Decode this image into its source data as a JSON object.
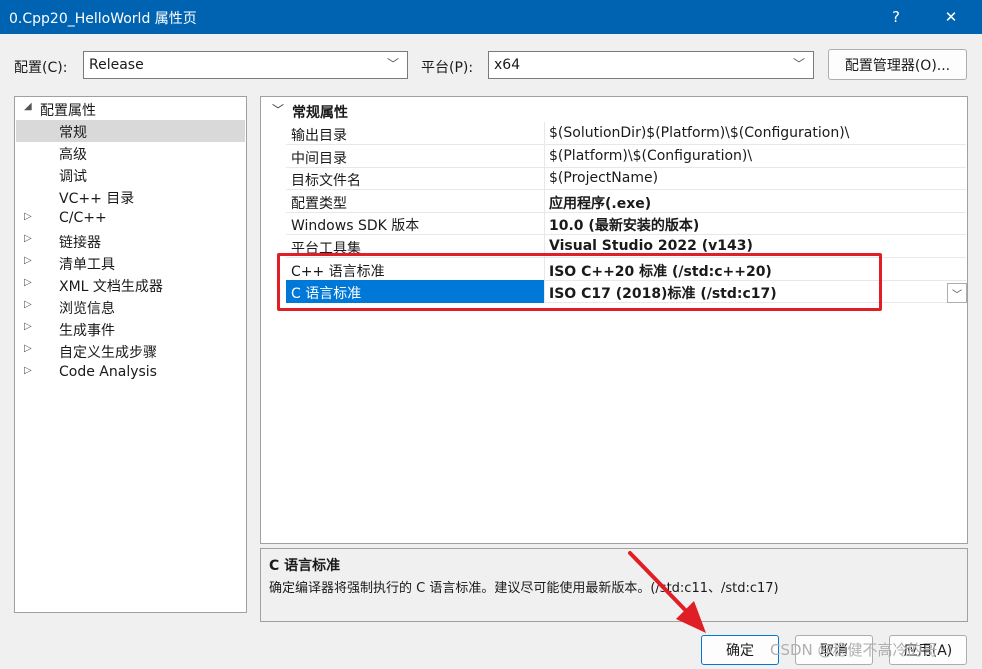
{
  "window": {
    "title": "0.Cpp20_HelloWorld 属性页",
    "help_glyph": "?",
    "close_glyph": "✕"
  },
  "config": {
    "label": "配置(C):",
    "value": "Release",
    "platform_label": "平台(P):",
    "platform_value": "x64",
    "manager_button": "配置管理器(O)..."
  },
  "tree": {
    "items": [
      {
        "label": "配置属性",
        "expander": "◢",
        "level": 0,
        "selected": false
      },
      {
        "label": "常规",
        "expander": "",
        "level": 1,
        "selected": true
      },
      {
        "label": "高级",
        "expander": "",
        "level": 1,
        "selected": false
      },
      {
        "label": "调试",
        "expander": "",
        "level": 1,
        "selected": false
      },
      {
        "label": "VC++ 目录",
        "expander": "",
        "level": 1,
        "selected": false
      },
      {
        "label": "C/C++",
        "expander": "▷",
        "level": 1,
        "selected": false
      },
      {
        "label": "链接器",
        "expander": "▷",
        "level": 1,
        "selected": false
      },
      {
        "label": "清单工具",
        "expander": "▷",
        "level": 1,
        "selected": false
      },
      {
        "label": "XML 文档生成器",
        "expander": "▷",
        "level": 1,
        "selected": false
      },
      {
        "label": "浏览信息",
        "expander": "▷",
        "level": 1,
        "selected": false
      },
      {
        "label": "生成事件",
        "expander": "▷",
        "level": 1,
        "selected": false
      },
      {
        "label": "自定义生成步骤",
        "expander": "▷",
        "level": 1,
        "selected": false
      },
      {
        "label": "Code Analysis",
        "expander": "▷",
        "level": 1,
        "selected": false
      }
    ]
  },
  "grid": {
    "category": "常规属性",
    "rows": [
      {
        "name": "输出目录",
        "value": "$(SolutionDir)$(Platform)\\$(Configuration)\\",
        "bold": false
      },
      {
        "name": "中间目录",
        "value": "$(Platform)\\$(Configuration)\\",
        "bold": false
      },
      {
        "name": "目标文件名",
        "value": "$(ProjectName)",
        "bold": false
      },
      {
        "name": "配置类型",
        "value": "应用程序(.exe)",
        "bold": true
      },
      {
        "name": "Windows SDK 版本",
        "value": "10.0 (最新安装的版本)",
        "bold": true
      },
      {
        "name": "平台工具集",
        "value": "Visual Studio 2022 (v143)",
        "bold": true
      },
      {
        "name": "C++ 语言标准",
        "value": "ISO C++20 标准 (/std:c++20)",
        "bold": true
      },
      {
        "name": "C 语言标准",
        "value": "ISO C17 (2018)标准 (/std:c17)",
        "bold": true
      }
    ],
    "selected_row": 7
  },
  "description": {
    "title": "C 语言标准",
    "text": "确定编译器将强制执行的 C 语言标准。建议尽可能使用最新版本。(/std:c11、/std:c17)"
  },
  "buttons": {
    "ok": "确定",
    "cancel": "取消",
    "apply": "应用(A)"
  },
  "watermark": "CSDN @稳健不高冷的哥",
  "colors": {
    "titlebar": "#0063b1",
    "selection": "#0078d7",
    "highlight_box": "#e01e25"
  }
}
